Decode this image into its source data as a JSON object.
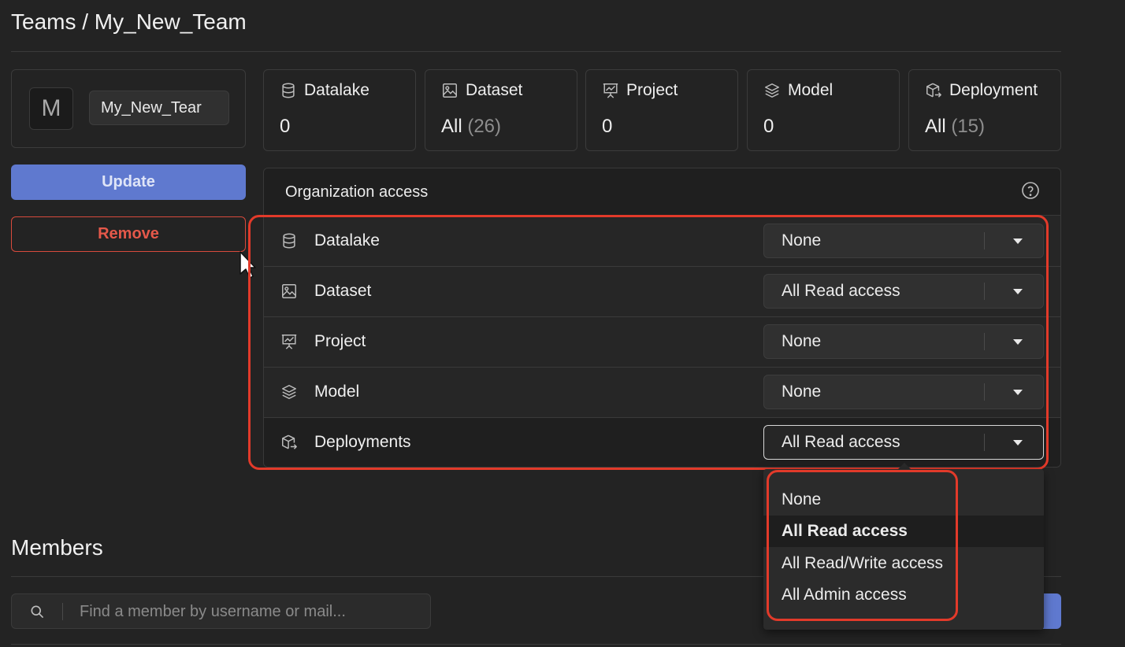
{
  "breadcrumb": "Teams / My_New_Team",
  "team": {
    "avatar_letter": "M",
    "name_value": "My_New_Tear"
  },
  "actions": {
    "update_label": "Update",
    "remove_label": "Remove"
  },
  "stats": [
    {
      "label": "Datalake",
      "value": "0",
      "count": "",
      "icon": "database-icon"
    },
    {
      "label": "Dataset",
      "value": "All",
      "count": "(26)",
      "icon": "image-icon"
    },
    {
      "label": "Project",
      "value": "0",
      "count": "",
      "icon": "presentation-chart-icon"
    },
    {
      "label": "Model",
      "value": "0",
      "count": "",
      "icon": "layers-icon"
    },
    {
      "label": "Deployment",
      "value": "All",
      "count": "(15)",
      "icon": "box-arrow-icon"
    }
  ],
  "org_access": {
    "title": "Organization access",
    "rows": [
      {
        "label": "Datalake",
        "value": "None",
        "icon": "database-icon"
      },
      {
        "label": "Dataset",
        "value": "All Read access",
        "icon": "image-icon"
      },
      {
        "label": "Project",
        "value": "None",
        "icon": "presentation-chart-icon"
      },
      {
        "label": "Model",
        "value": "None",
        "icon": "layers-icon"
      },
      {
        "label": "Deployments",
        "value": "All Read access",
        "icon": "box-arrow-icon"
      }
    ]
  },
  "dropdown": {
    "options": [
      "None",
      "All Read access",
      "All Read/Write access",
      "All Admin access"
    ],
    "selected": "All Read access"
  },
  "members": {
    "title": "Members",
    "search_placeholder": "Find a member by username or mail..."
  },
  "colors": {
    "accent": "#5f79cf",
    "danger": "#e5584a",
    "annotation": "#e23a2a",
    "background": "#232323"
  }
}
